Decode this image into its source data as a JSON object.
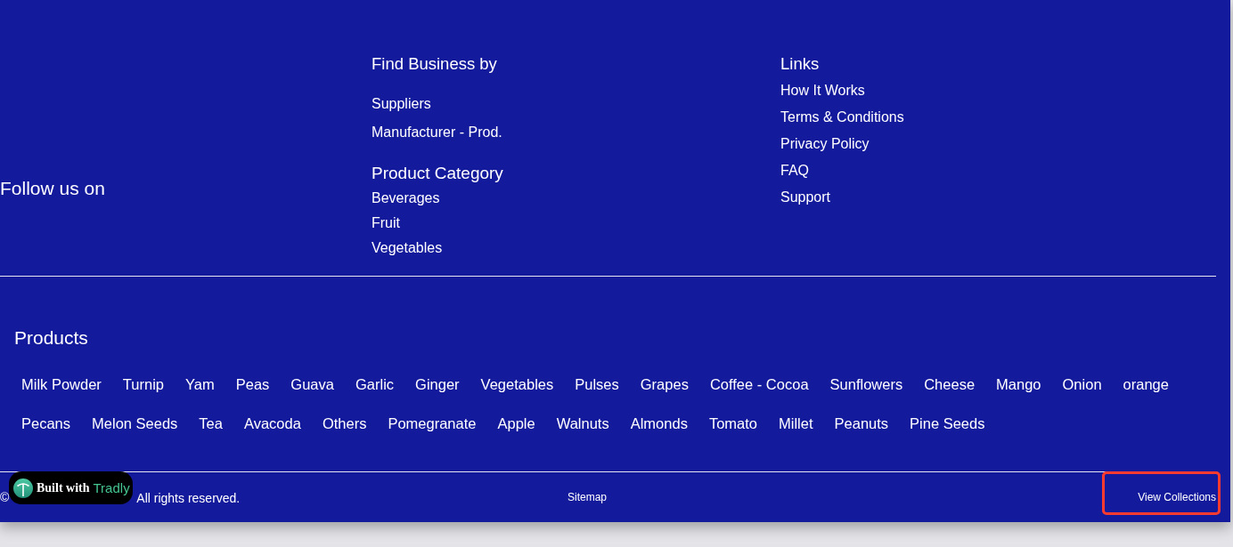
{
  "follow": {
    "label": "Follow us on"
  },
  "find_business": {
    "heading": "Find Business by",
    "links": [
      "Suppliers",
      "Manufacturer - Prod."
    ]
  },
  "product_category": {
    "heading": "Product Category",
    "links": [
      "Beverages",
      "Fruit",
      "Vegetables"
    ]
  },
  "links": {
    "heading": "Links",
    "items": [
      "How It Works",
      "Terms & Conditions",
      "Privacy Policy",
      "FAQ",
      "Support"
    ]
  },
  "products": {
    "heading": "Products",
    "items": [
      "Milk Powder",
      "Turnip",
      "Yam",
      "Peas",
      "Guava",
      "Garlic",
      "Ginger",
      "Vegetables",
      "Pulses",
      "Grapes",
      "Coffee - Cocoa",
      "Sunflowers",
      "Cheese",
      "Mango",
      "Onion",
      "orange",
      "Pecans",
      "Melon Seeds",
      "Tea",
      "Avacoda",
      "Others",
      "Pomegranate",
      "Apple",
      "Walnuts",
      "Almonds",
      "Tomato",
      "Millet",
      "Peanuts",
      "Pine Seeds"
    ]
  },
  "bottom_bar": {
    "copyright_symbol": "©",
    "copyright": "All rights reserved.",
    "sitemap": "Sitemap",
    "view_collections": {
      "label": "View Collections",
      "highlighted": true
    }
  },
  "badge": {
    "prefix": "Built with",
    "brand": "Tradly"
  }
}
